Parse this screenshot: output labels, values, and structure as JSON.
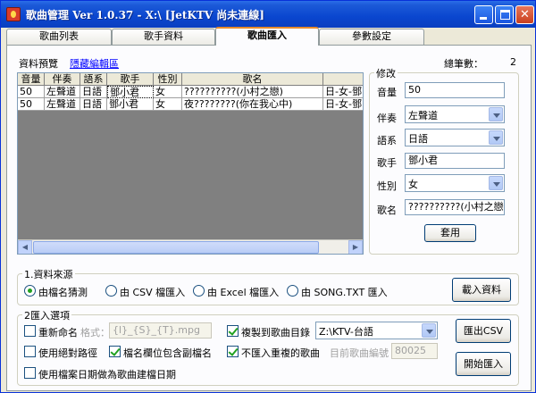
{
  "window": {
    "title": "歌曲管理  Ver 1.0.37 - X:\\  [JetKTV 尚未連線]"
  },
  "tabs": [
    {
      "label": "歌曲列表"
    },
    {
      "label": "歌手資料"
    },
    {
      "label": "歌曲匯入"
    },
    {
      "label": "參數設定"
    }
  ],
  "preview": {
    "label": "資料預覽",
    "toggle_link": "隱藏編輯區",
    "total_label": "總筆數：",
    "total_value": "2"
  },
  "grid": {
    "columns": [
      "音量",
      "伴奏",
      "語系",
      "歌手",
      "性別",
      "歌名",
      ""
    ],
    "rows": [
      [
        "50",
        "左聲道",
        "日語",
        "鄧小君",
        "女",
        "??????????(小村之戀)",
        "日-女-鄧"
      ],
      [
        "50",
        "左聲道",
        "日語",
        "鄧小君",
        "女",
        "夜????????(你在我心中)",
        "日-女-鄧"
      ]
    ]
  },
  "edit": {
    "title": "修改",
    "volume_label": "音量",
    "volume_value": "50",
    "accomp_label": "伴奏",
    "accomp_value": "左聲道",
    "lang_label": "語系",
    "lang_value": "日語",
    "singer_label": "歌手",
    "singer_value": "鄧小君",
    "gender_label": "性別",
    "gender_value": "女",
    "song_label": "歌名",
    "song_value": "??????????(小村之戀)",
    "apply_button": "套用"
  },
  "source": {
    "title": "1.資料來源",
    "options": [
      {
        "label": "由檔名猜測",
        "selected": true
      },
      {
        "label": "由 CSV 檔匯入",
        "selected": false
      },
      {
        "label": "由 Excel 檔匯入",
        "selected": false
      },
      {
        "label": "由 SONG.TXT 匯入",
        "selected": false
      }
    ],
    "load_button": "載入資料"
  },
  "options": {
    "title": "2匯入選項",
    "rename_label": "重新命名",
    "rename_checked": false,
    "format_label": "格式：",
    "format_value": "{l}_{S}_{T}.mpg",
    "relpath_label": "使用絕對路徑",
    "relpath_checked": false,
    "subname_label": "檔名欄位包含副檔名",
    "subname_checked": true,
    "filedate_label": "使用檔案日期做為歌曲建檔日期",
    "filedate_checked": false,
    "copy_label": "複製到歌曲目錄",
    "copy_checked": true,
    "copy_dir": "Z:\\KTV-台語",
    "nodup_label": "不匯入重複的歌曲",
    "nodup_checked": true,
    "curno_label": "目前歌曲編號",
    "curno_value": "80025",
    "export_button": "匯出CSV",
    "start_button": "開始匯入"
  },
  "colors": {
    "titlebar": "#0a46cf",
    "active_tab_accent": "#e68b2c",
    "link": "#0000ff"
  }
}
